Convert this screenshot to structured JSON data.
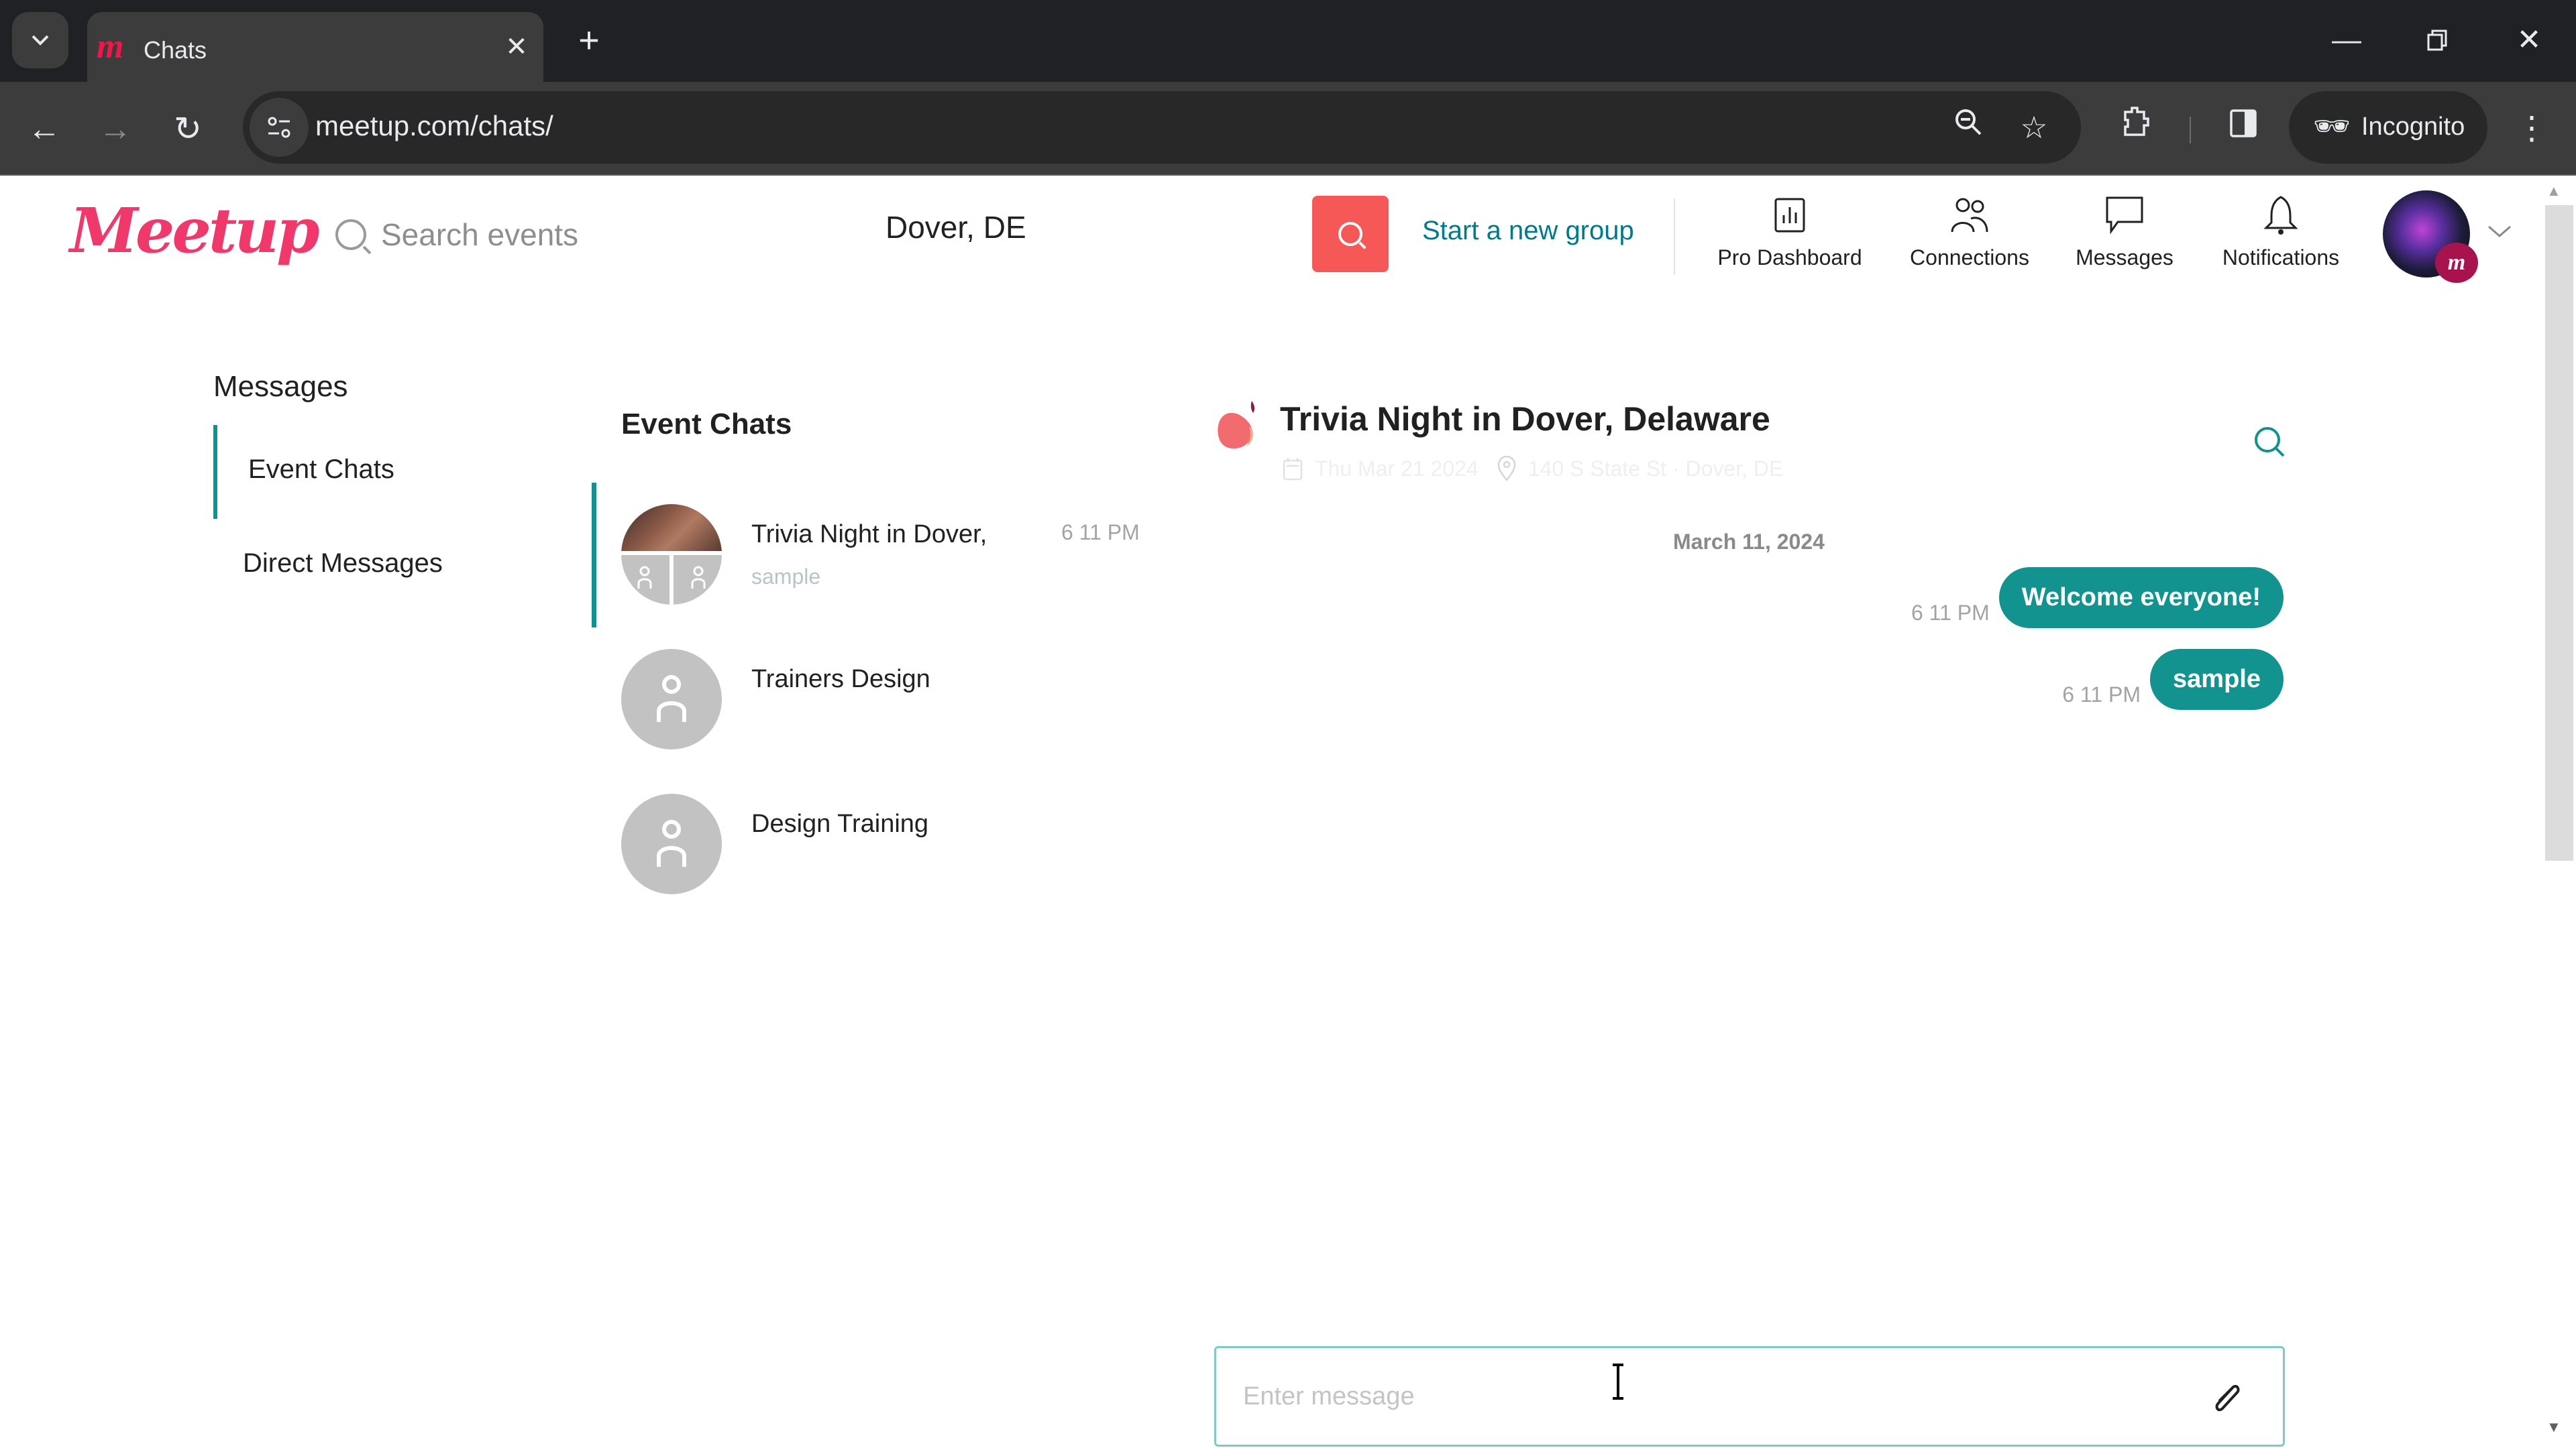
{
  "browser": {
    "tab_title": "Chats",
    "url": "meetup.com/chats/",
    "incognito_label": "Incognito",
    "icons": {
      "tab_search": "chevron-down-icon",
      "close_tab": "close-icon",
      "new_tab": "plus-icon",
      "minimize": "minimize-icon",
      "restore": "restore-icon",
      "close_window": "close-icon",
      "back": "arrow-left-icon",
      "forward": "arrow-right-icon",
      "reload": "reload-icon",
      "site_info": "tune-icon",
      "zoom": "zoom-out-icon",
      "bookmark": "star-icon",
      "extensions": "puzzle-icon",
      "side_panel": "side-panel-icon",
      "menu": "kebab-menu-icon"
    }
  },
  "header": {
    "logo_text": "Meetup",
    "search_placeholder": "Search events",
    "location_value": "Dover, DE",
    "start_group_label": "Start a new group",
    "nav": [
      {
        "label": "Pro Dashboard",
        "icon": "bar-chart-icon"
      },
      {
        "label": "Connections",
        "icon": "people-icon"
      },
      {
        "label": "Messages",
        "icon": "chat-bubble-icon"
      },
      {
        "label": "Notifications",
        "icon": "bell-icon"
      }
    ],
    "avatar_badge": "m"
  },
  "sidebar": {
    "title": "Messages",
    "items": [
      {
        "label": "Event Chats",
        "active": true
      },
      {
        "label": "Direct Messages",
        "active": false
      }
    ]
  },
  "chat_list": {
    "title": "Event Chats",
    "items": [
      {
        "name": "Trivia Night in Dover,",
        "preview": "sample",
        "time": "6 11 PM",
        "active": true
      },
      {
        "name": "Trainers Design",
        "preview": "",
        "time": "",
        "active": false
      },
      {
        "name": "Design Training",
        "preview": "",
        "time": "",
        "active": false
      }
    ]
  },
  "conversation": {
    "title": "Trivia Night in Dover, Delaware",
    "event_date": "Thu Mar 21 2024",
    "event_location": "140 S State St · Dover, DE",
    "date_divider": "March 11, 2024",
    "messages": [
      {
        "text": "Welcome everyone!",
        "time": "6 11 PM",
        "outgoing": true
      },
      {
        "text": "sample",
        "time": "6 11 PM",
        "outgoing": true
      }
    ],
    "composer_placeholder": "Enter message",
    "composer_value": ""
  },
  "colors": {
    "brand": "#f0386b",
    "accent_teal": "#12938f",
    "search_button": "#f65858",
    "link_teal": "#00798a"
  }
}
